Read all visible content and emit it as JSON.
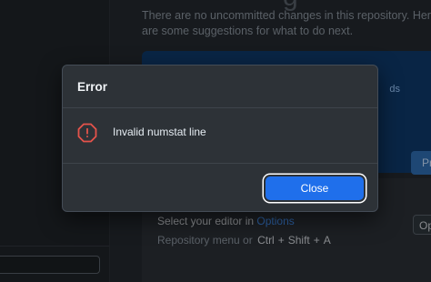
{
  "background": {
    "title_fragment": "g",
    "intro_text": "There are no uncommitted changes in this repository. Here are some suggestions for what to do next.",
    "card_chip_text": "ds",
    "card_button_text": "Pre",
    "editor": {
      "prefix": "Select your editor in",
      "link": "Options",
      "shortcut_prefix": "Repository menu or",
      "keys": [
        "Ctrl",
        "+",
        "Shift",
        "+",
        "A"
      ],
      "open_button_text": "Op"
    }
  },
  "dialog": {
    "title": "Error",
    "message": "Invalid numstat line",
    "close_label": "Close",
    "icon": "error-octagon-icon",
    "colors": {
      "accent": "#1f6feb",
      "error": "#e5534b",
      "surface": "#2d3237"
    }
  }
}
